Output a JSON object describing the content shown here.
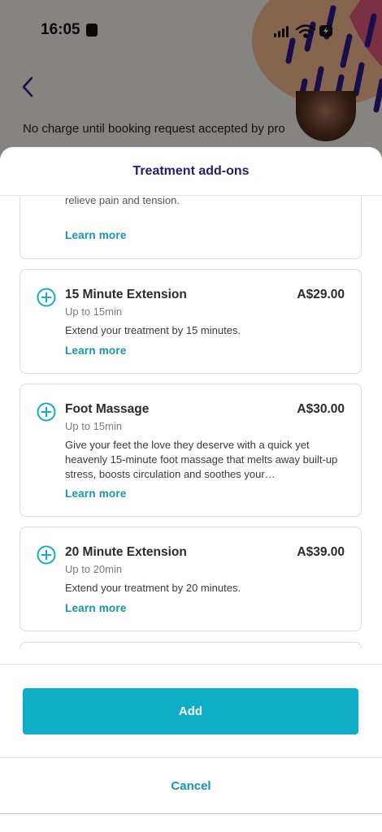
{
  "status_bar": {
    "time": "16:05"
  },
  "background": {
    "notice": "No charge until booking request accepted by pro"
  },
  "sheet": {
    "title": "Treatment add-ons",
    "partial_top": {
      "text_fragment": "relieve pain and tension.",
      "learn_more": "Learn more"
    },
    "items": [
      {
        "name": "15 Minute Extension",
        "price": "A$29.00",
        "duration": "Up to 15min",
        "description": "Extend your treatment by 15 minutes.",
        "learn_more": "Learn more"
      },
      {
        "name": "Foot Massage",
        "price": "A$30.00",
        "duration": "Up to 15min",
        "description": "Give your feet the love they deserve with a quick yet heavenly 15-minute foot massage that melts away built-up stress, boosts circulation and soothes your…",
        "learn_more": "Learn more"
      },
      {
        "name": "20 Minute Extension",
        "price": "A$39.00",
        "duration": "Up to 20min",
        "description": "Extend your treatment by 20 minutes.",
        "learn_more": "Learn more"
      }
    ],
    "add_button": "Add",
    "cancel_button": "Cancel"
  },
  "colors": {
    "accent": "#0eaec8",
    "link": "#1596ad",
    "title": "#2a1a6e"
  }
}
